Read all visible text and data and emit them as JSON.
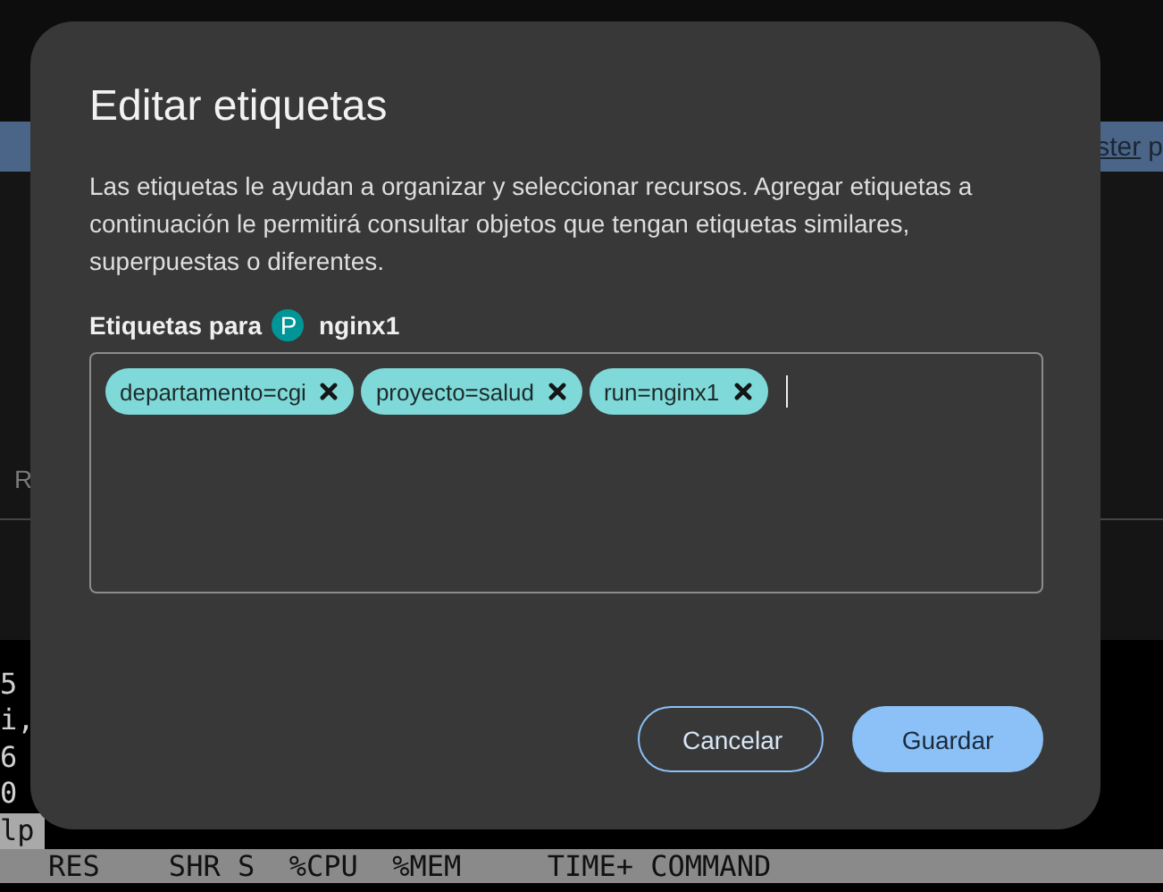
{
  "background": {
    "banner_link": "ster",
    "banner_text": "p",
    "side_letter": "R",
    "terminal_lines": [
      {
        "text": "5",
        "highlighted": false
      },
      {
        "text": "i,",
        "highlighted": false
      },
      {
        "text": "6",
        "highlighted": false
      },
      {
        "text": "0",
        "highlighted": false
      },
      {
        "text": "lp",
        "highlighted": true
      }
    ],
    "status_header": "RES    SHR S  %CPU  %MEM     TIME+ COMMAND"
  },
  "dialog": {
    "title": "Editar etiquetas",
    "description": "Las etiquetas le ayudan a organizar y seleccionar recursos. Agregar etiquetas a continuación le permitirá consultar objetos que tengan etiquetas similares, superpuestas o diferentes.",
    "label": "Etiquetas para",
    "resource_badge": "P",
    "resource_name": "nginx1",
    "labels": [
      {
        "text": "departamento=cgi"
      },
      {
        "text": "proyecto=salud"
      },
      {
        "text": "run=nginx1"
      }
    ],
    "buttons": [
      {
        "label": "Cancelar",
        "kind": "secondary"
      },
      {
        "label": "Guardar",
        "kind": "primary"
      }
    ]
  }
}
